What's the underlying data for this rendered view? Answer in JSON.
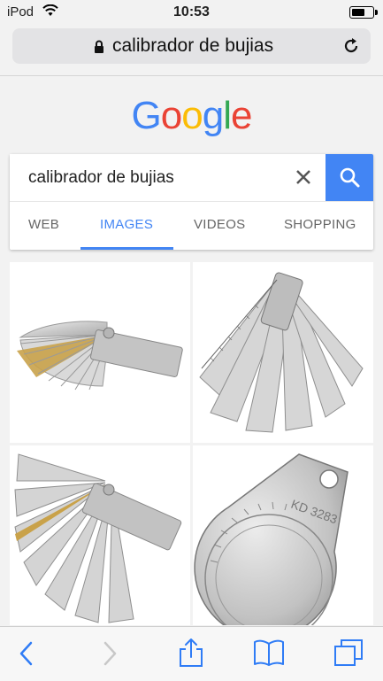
{
  "status": {
    "carrier": "iPod",
    "time": "10:53"
  },
  "address": {
    "url": "calibrador de bujias"
  },
  "logo": [
    "G",
    "o",
    "o",
    "g",
    "l",
    "e"
  ],
  "logo_colors": [
    "#4285f4",
    "#ea4335",
    "#fbbc05",
    "#4285f4",
    "#34a853",
    "#ea4335"
  ],
  "search": {
    "query": "calibrador de bujias"
  },
  "tabs": [
    {
      "label": "WEB",
      "active": false
    },
    {
      "label": "IMAGES",
      "active": true
    },
    {
      "label": "VIDEOS",
      "active": false
    },
    {
      "label": "SHOPPING",
      "active": false
    }
  ],
  "accent": "#4285f4",
  "toolbar": [
    "back-icon",
    "forward-icon",
    "share-icon",
    "bookmarks-icon",
    "tabs-icon"
  ]
}
